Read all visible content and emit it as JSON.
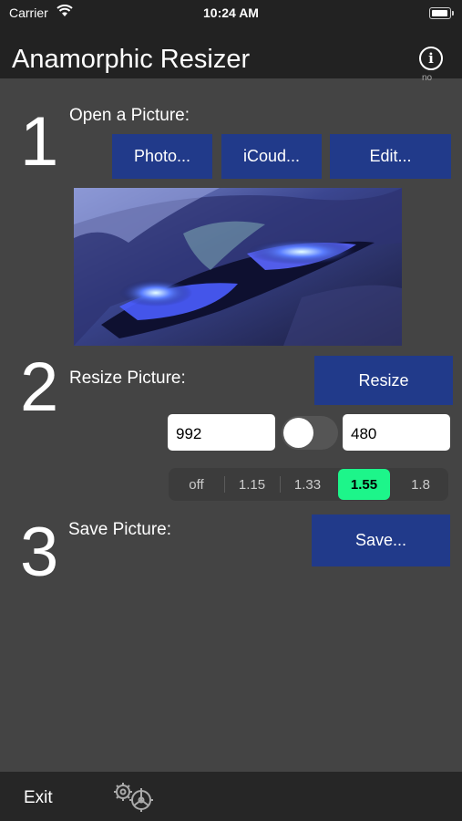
{
  "status": {
    "carrier": "Carrier",
    "time": "10:24 AM"
  },
  "nav": {
    "title": "Anamorphic Resizer",
    "info_label": "no"
  },
  "step1": {
    "number": "1",
    "label": "Open a Picture:",
    "buttons": [
      "Photo...",
      "iCoud...",
      "Edit..."
    ]
  },
  "step2": {
    "number": "2",
    "label": "Resize Picture:",
    "resize_label": "Resize",
    "width": "992",
    "height": "480",
    "ratios": [
      "off",
      "1.15",
      "1.33",
      "1.55",
      "1.8"
    ],
    "selected_ratio": "1.55"
  },
  "step3": {
    "number": "3",
    "label": "Save Picture:",
    "save_label": "Save..."
  },
  "toolbar": {
    "exit_label": "Exit"
  },
  "colors": {
    "background": "#444444",
    "button": "#213a8a",
    "selected_segment": "#1df58a",
    "bars": "#222222"
  }
}
